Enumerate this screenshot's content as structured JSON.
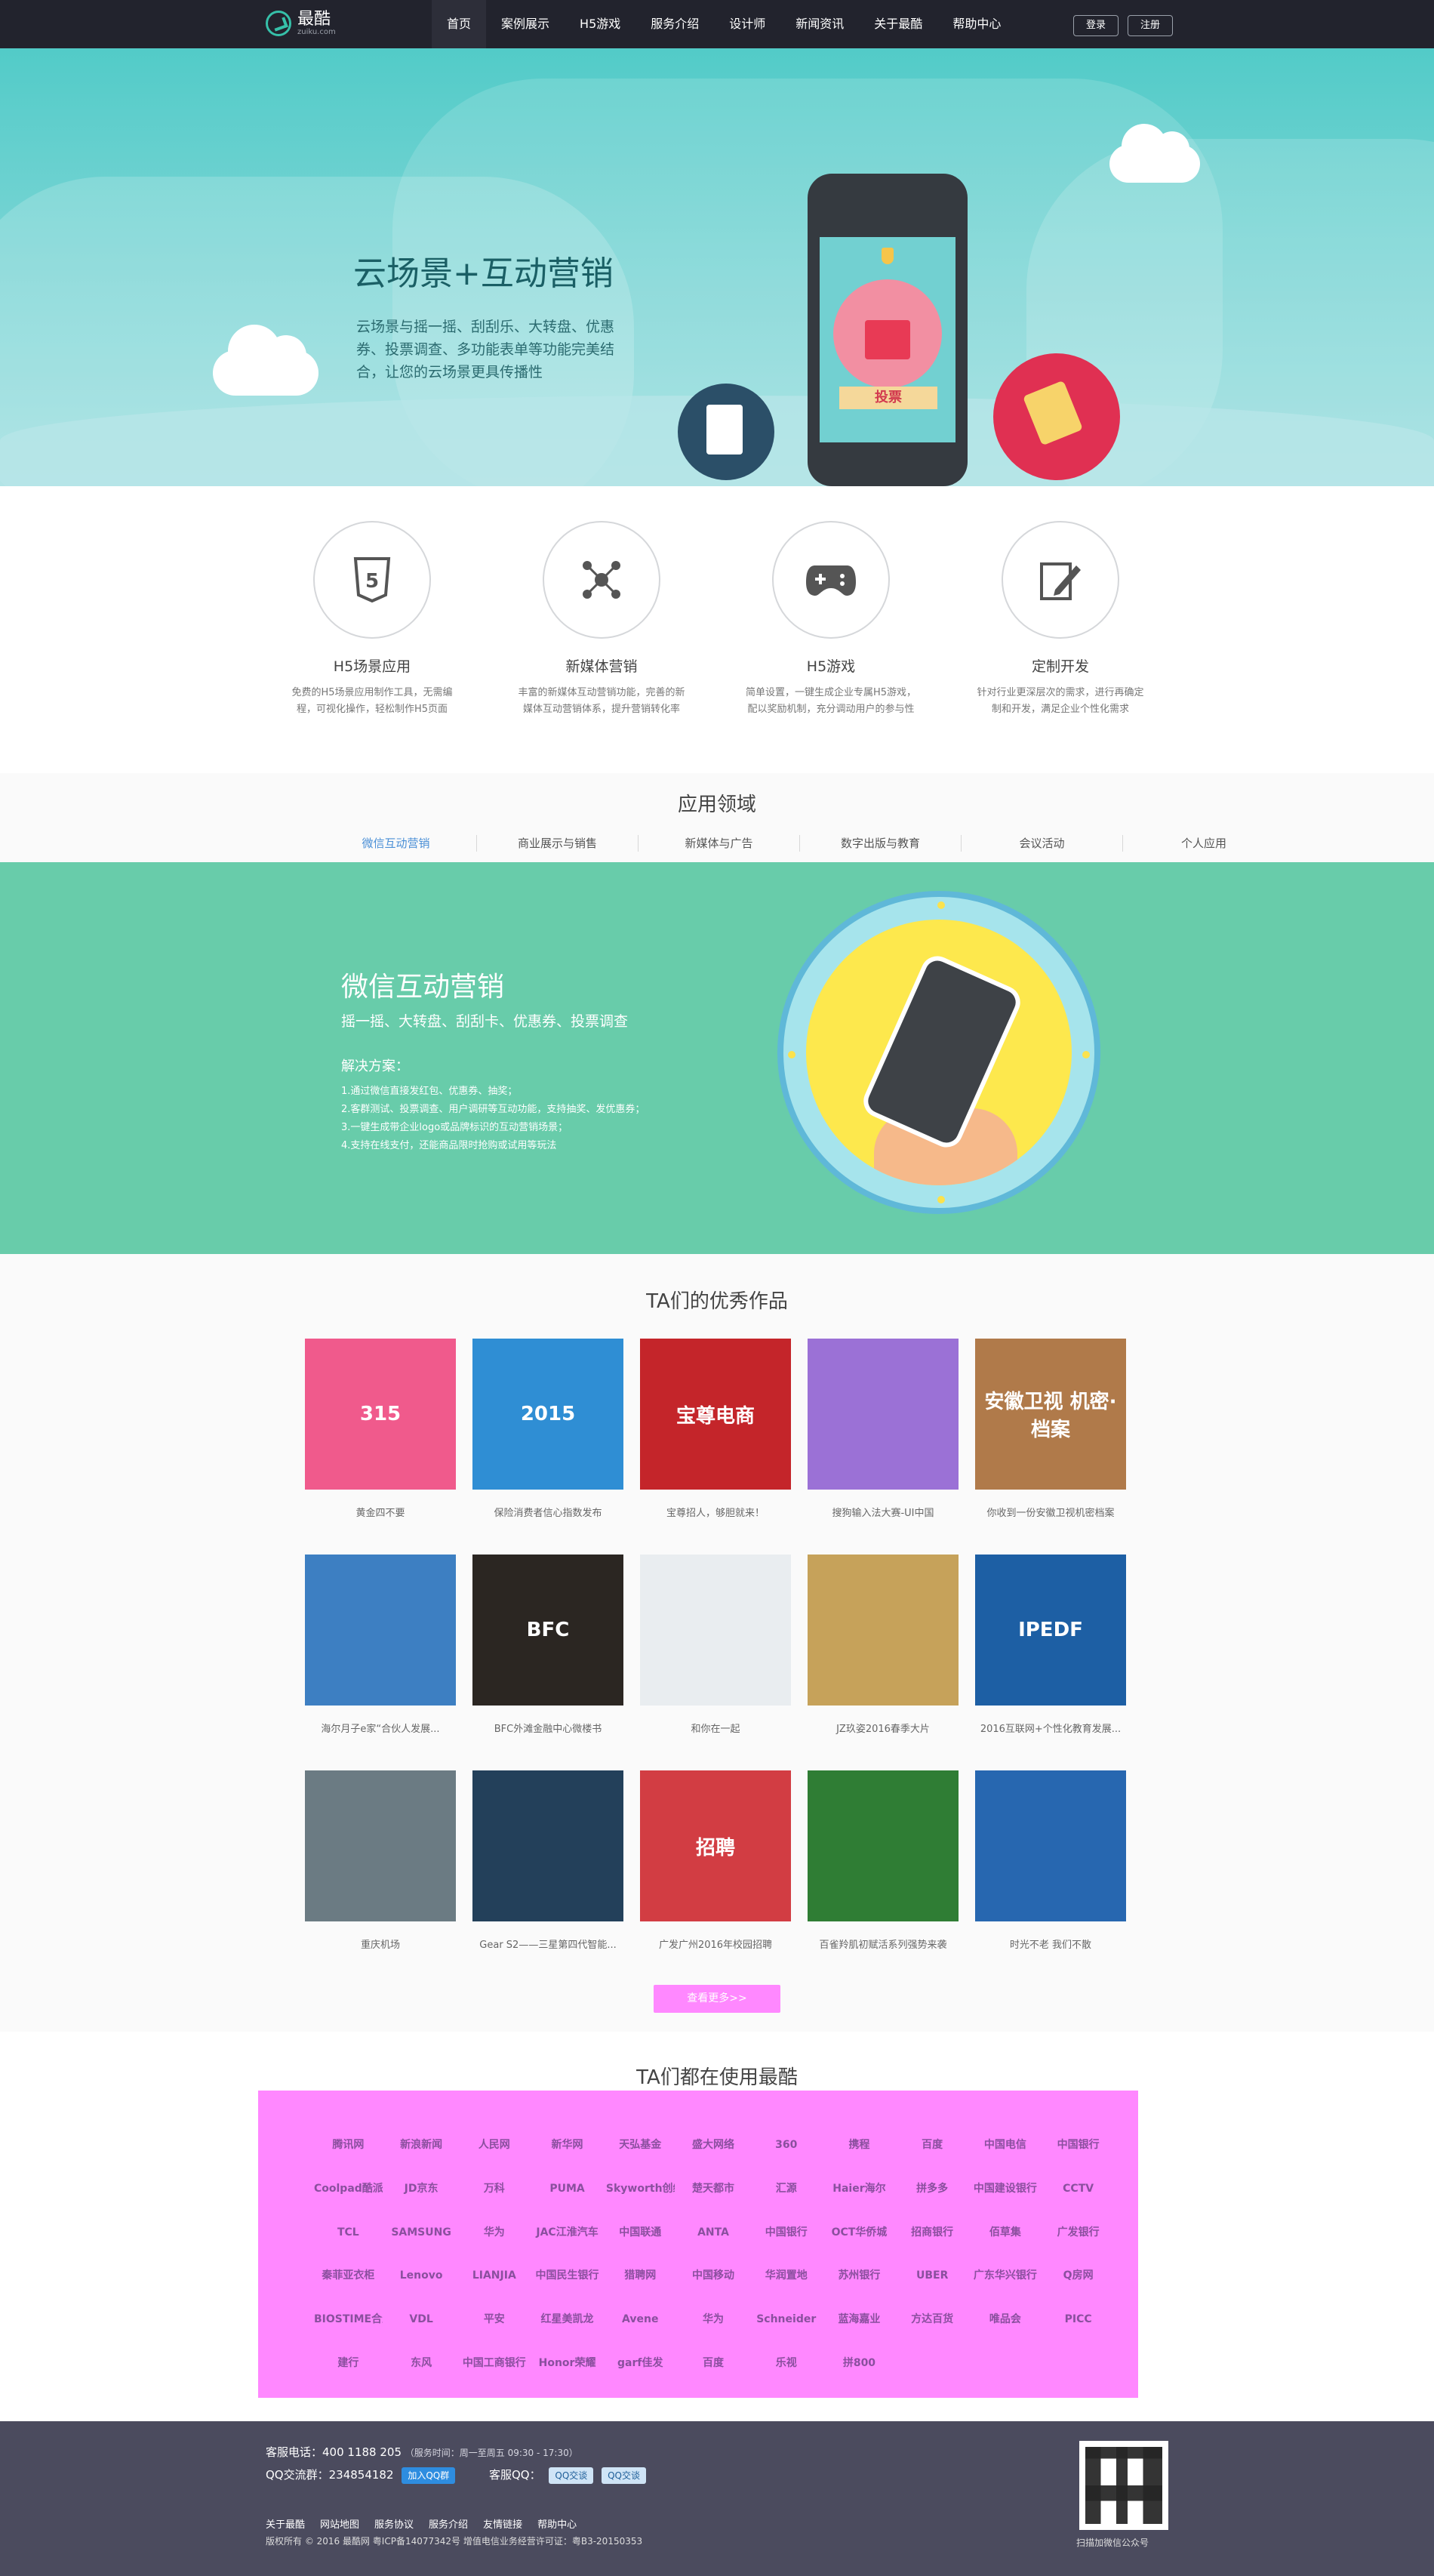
{
  "header": {
    "logo_text": "最酷",
    "logo_sub": "zuiku.com",
    "nav": [
      "首页",
      "案例展示",
      "H5游戏",
      "服务介绍",
      "设计师",
      "新闻资讯",
      "关于最酷",
      "帮助中心"
    ],
    "login": "登录",
    "register": "注册"
  },
  "hero": {
    "title": "云场景+互动营销",
    "desc": "云场景与摇一摇、刮刮乐、大转盘、优惠券、投票调查、多功能表单等功能完美结合，让您的云场景更具传播性",
    "vote_label": "投票"
  },
  "services": [
    {
      "title": "H5场景应用",
      "desc": "免费的H5场景应用制作工具，无需编程，可视化操作，轻松制作H5页面"
    },
    {
      "title": "新媒体营销",
      "desc": "丰富的新媒体互动营销功能，完善的新媒体互动营销体系，提升营销转化率"
    },
    {
      "title": "H5游戏",
      "desc": "简单设置，一键生成企业专属H5游戏，配以奖励机制，充分调动用户的参与性"
    },
    {
      "title": "定制开发",
      "desc": "针对行业更深层次的需求，进行再确定制和开发，满足企业个性化需求"
    }
  ],
  "apply": {
    "title": "应用领域",
    "tabs": [
      "微信互动营销",
      "商业展示与销售",
      "新媒体与广告",
      "数字出版与教育",
      "会议活动",
      "个人应用"
    ]
  },
  "wechat": {
    "title": "微信互动营销",
    "subtitle": "摇一摇、大转盘、刮刮卡、优惠券、投票调查",
    "solution_label": "解决方案：",
    "solutions": [
      "1.通过微信直接发红包、优惠券、抽奖；",
      "2.客群测试、投票调查、用户调研等互动功能，支持抽奖、发优惠券；",
      "3.一键生成带企业logo或品牌标识的互动营销场景；",
      "4.支持在线支付，还能商品限时抢购或试用等玩法"
    ]
  },
  "works": {
    "title": "TA们的优秀作品",
    "items": [
      {
        "caption": "黄金四不要",
        "thumb_text": "315",
        "color": "#f05a8c"
      },
      {
        "caption": "保险消费者信心指数发布",
        "thumb_text": "2015",
        "color": "#2f8ed4"
      },
      {
        "caption": "宝尊招人，够胆就来！",
        "thumb_text": "宝尊电商",
        "color": "#c4252a"
      },
      {
        "caption": "搜狗输入法大赛-UI中国",
        "thumb_text": "",
        "color": "#9b71d6"
      },
      {
        "caption": "你收到一份安徽卫视机密档案",
        "thumb_text": "安徽卫视 机密·档案",
        "color": "#b07a4a"
      },
      {
        "caption": "海尔月子e家“合伙人发展...",
        "thumb_text": "",
        "color": "#3d7fc2"
      },
      {
        "caption": "BFC外滩金融中心微楼书",
        "thumb_text": "BFC",
        "color": "#2b2622"
      },
      {
        "caption": "和你在一起",
        "thumb_text": "",
        "color": "#e9edf0"
      },
      {
        "caption": "JZ玖姿2016春季大片",
        "thumb_text": "",
        "color": "#c6a25a"
      },
      {
        "caption": "2016互联网+个性化教育发展...",
        "thumb_text": "IPEDF",
        "color": "#1d5fa4"
      },
      {
        "caption": "重庆机场",
        "thumb_text": "",
        "color": "#6b7b83"
      },
      {
        "caption": "Gear S2——三星第四代智能...",
        "thumb_text": "",
        "color": "#23405a"
      },
      {
        "caption": "广发广州2016年校园招聘",
        "thumb_text": "招聘",
        "color": "#d23d43"
      },
      {
        "caption": "百雀羚肌初赋活系列强势来袭",
        "thumb_text": "",
        "color": "#2f7d34"
      },
      {
        "caption": "时光不老 我们不散",
        "thumb_text": "",
        "color": "#2767b0"
      }
    ],
    "more": "查看更多>>"
  },
  "clients": {
    "title": "TA们都在使用最酷",
    "brands": [
      "腾讯网",
      "新浪新闻",
      "人民网",
      "新华网",
      "天弘基金",
      "盛大网络",
      "360",
      "携程",
      "百度",
      "中国电信",
      "中国银行",
      "Coolpad酷派",
      "JD京东",
      "万科",
      "PUMA",
      "Skyworth创维",
      "楚天都市",
      "汇源",
      "Haier海尔",
      "拼多多",
      "中国建设银行",
      "CCTV",
      "TCL",
      "SAMSUNG",
      "华为",
      "JAC江淮汽车",
      "中国联通",
      "ANTA",
      "中国银行",
      "OCT华侨城",
      "招商银行",
      "佰草集",
      "广发银行",
      "秦菲亚衣柜",
      "Lenovo",
      "LIANJIA",
      "中国民生银行",
      "猎聘网",
      "中国移动",
      "华润置地",
      "苏州银行",
      "UBER",
      "广东华兴银行",
      "Q房网",
      "BIOSTIME合生元",
      "VDL",
      "平安",
      "红星美凯龙",
      "Avene",
      "华为",
      "Schneider",
      "蓝海嘉业",
      "方达百货",
      "唯品会",
      "PICC",
      "建行",
      "东风",
      "中国工商银行",
      "Honor荣耀",
      "garf佳发",
      "百度",
      "乐视",
      "拼800"
    ]
  },
  "footer": {
    "phone_label": "客服电话：",
    "phone": "400 1188 205",
    "hours": "（服务时间：周一至周五 09:30 - 17:30）",
    "qq_group_label": "QQ交流群：",
    "qq_group": "234854182",
    "join_qq": "加入QQ群",
    "cs_qq_label": "客服QQ：",
    "qq_chat_1": "QQ交谈",
    "qq_chat_2": "QQ交谈",
    "links": [
      "关于最酷",
      "网站地图",
      "服务协议",
      "服务介绍",
      "友情链接",
      "帮助中心"
    ],
    "copyright": "版权所有 © 2016  最酷网   粤ICP备14077342号   增值电信业务经营许可证：粤B3-20150353",
    "qr_label": "扫描加微信公众号"
  }
}
